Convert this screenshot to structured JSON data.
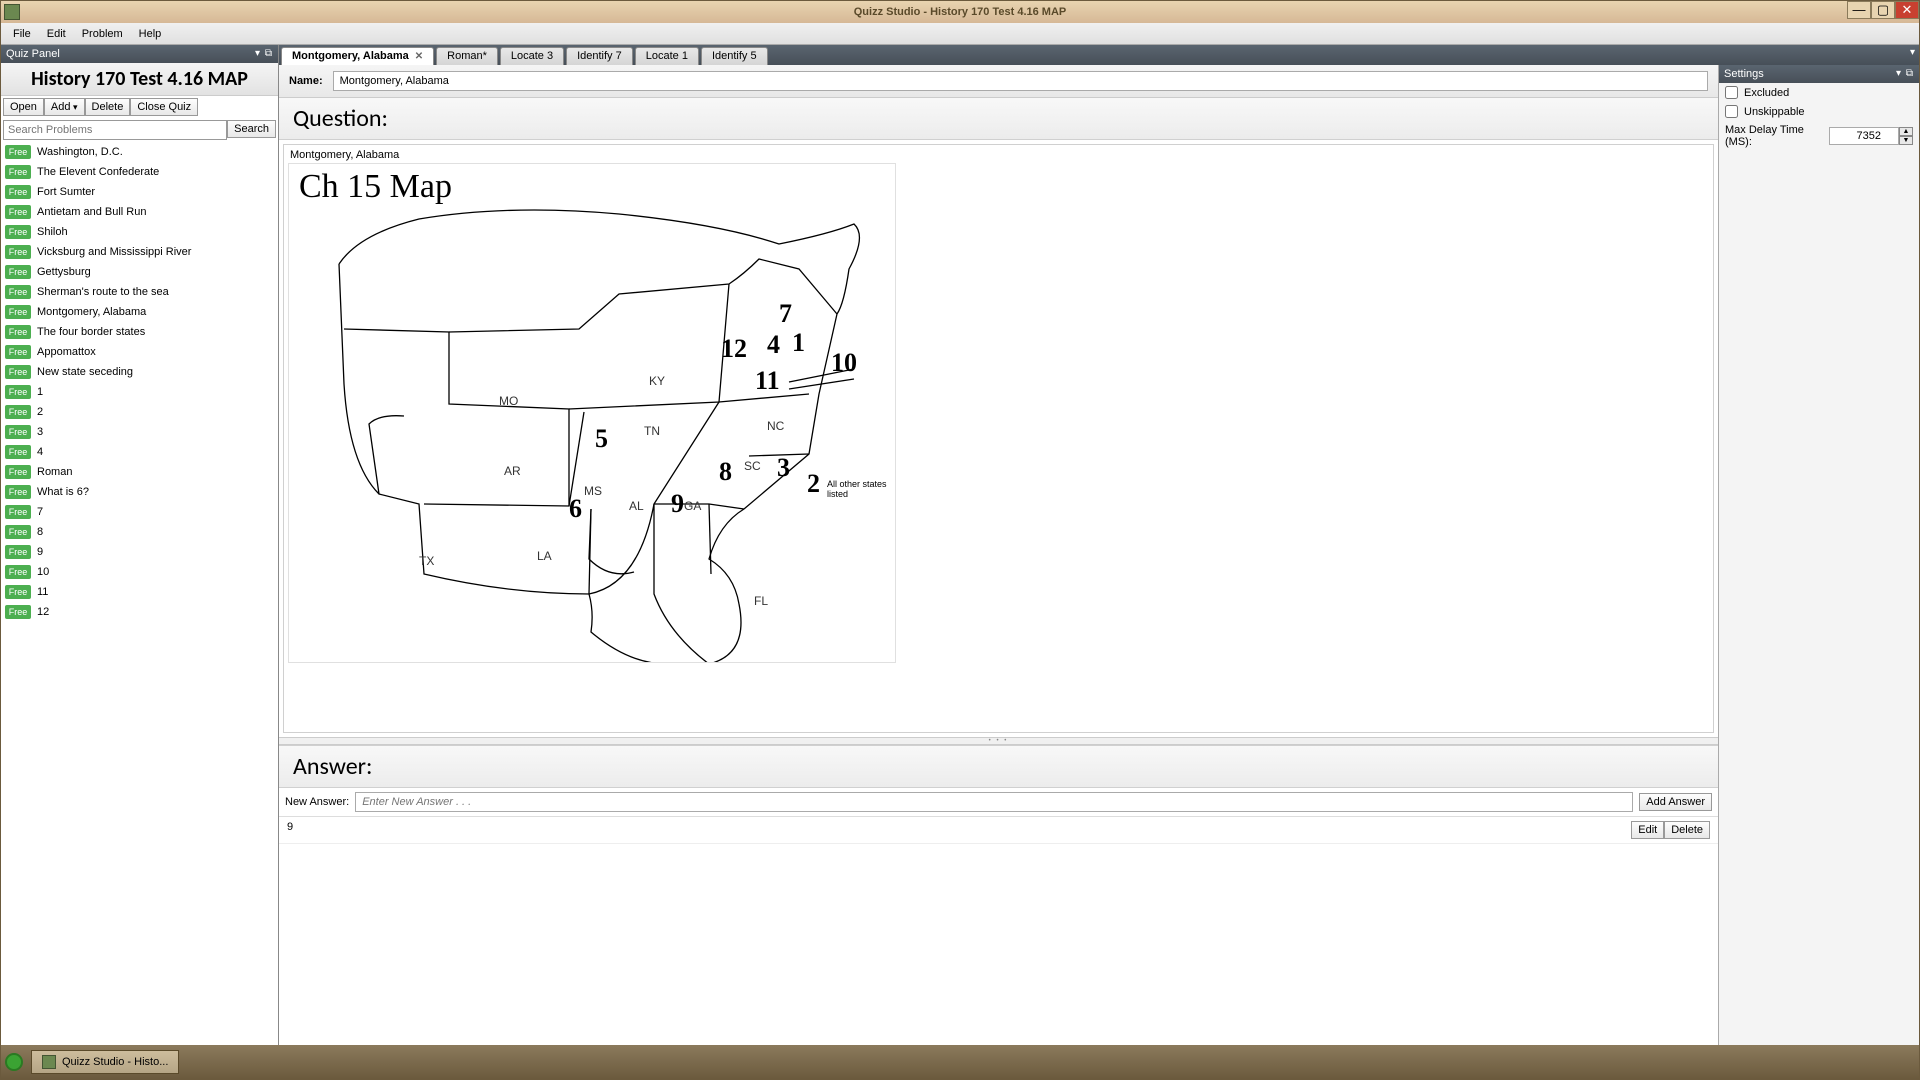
{
  "title": "Quizz Studio  - History 170 Test 4.16 MAP",
  "menus": [
    "File",
    "Edit",
    "Problem",
    "Help"
  ],
  "quiz_panel": {
    "header": "Quiz Panel",
    "quiz_title": "History 170 Test 4.16 MAP",
    "buttons": {
      "open": "Open",
      "add": "Add",
      "delete": "Delete",
      "close": "Close Quiz"
    },
    "search_placeholder": "Search Problems",
    "search_btn": "Search",
    "tag": "Free",
    "problems": [
      "Washington, D.C.",
      "The Elevent Confederate",
      "Fort Sumter",
      "Antietam and Bull Run",
      "Shiloh",
      "Vicksburg and Mississippi River",
      "Gettysburg",
      "Sherman's route to the sea",
      "Montgomery, Alabama",
      "The four border states",
      "Appomattox",
      "New state seceding",
      "1",
      "2",
      "3",
      "4",
      "Roman",
      "What is 6?",
      "7",
      "8",
      "9",
      "10",
      "11",
      "12"
    ]
  },
  "tabs": [
    {
      "label": "Montgomery, Alabama",
      "active": true,
      "closable": true
    },
    {
      "label": "Roman*",
      "active": false,
      "closable": false
    },
    {
      "label": "Locate 3",
      "active": false,
      "closable": false
    },
    {
      "label": "Identify 7",
      "active": false,
      "closable": false
    },
    {
      "label": "Locate 1",
      "active": false,
      "closable": false
    },
    {
      "label": "Identify 5",
      "active": false,
      "closable": false
    }
  ],
  "editor": {
    "name_label": "Name:",
    "name_value": "Montgomery, Alabama",
    "question_label": "Question:",
    "question_text": "Montgomery, Alabama",
    "map_title": "Ch 15 Map",
    "states": [
      "MO",
      "KY",
      "TN",
      "NC",
      "AR",
      "MS",
      "AL",
      "GA",
      "SC",
      "LA",
      "TX",
      "FL"
    ],
    "map_note": "All other states listed",
    "numbers": [
      "1",
      "2",
      "3",
      "4",
      "5",
      "6",
      "7",
      "8",
      "9",
      "10",
      "11",
      "12"
    ]
  },
  "answer": {
    "section": "Answer:",
    "new_label": "New Answer:",
    "new_placeholder": "Enter New Answer . . .",
    "add_btn": "Add Answer",
    "rows": [
      {
        "value": "9"
      }
    ],
    "edit": "Edit",
    "delete": "Delete"
  },
  "settings": {
    "header": "Settings",
    "excluded": "Excluded",
    "unskippable": "Unskippable",
    "delay_label": "Max Delay Time (MS):",
    "delay_value": "7352"
  },
  "taskbar": {
    "item": "Quizz Studio  - Histo..."
  }
}
